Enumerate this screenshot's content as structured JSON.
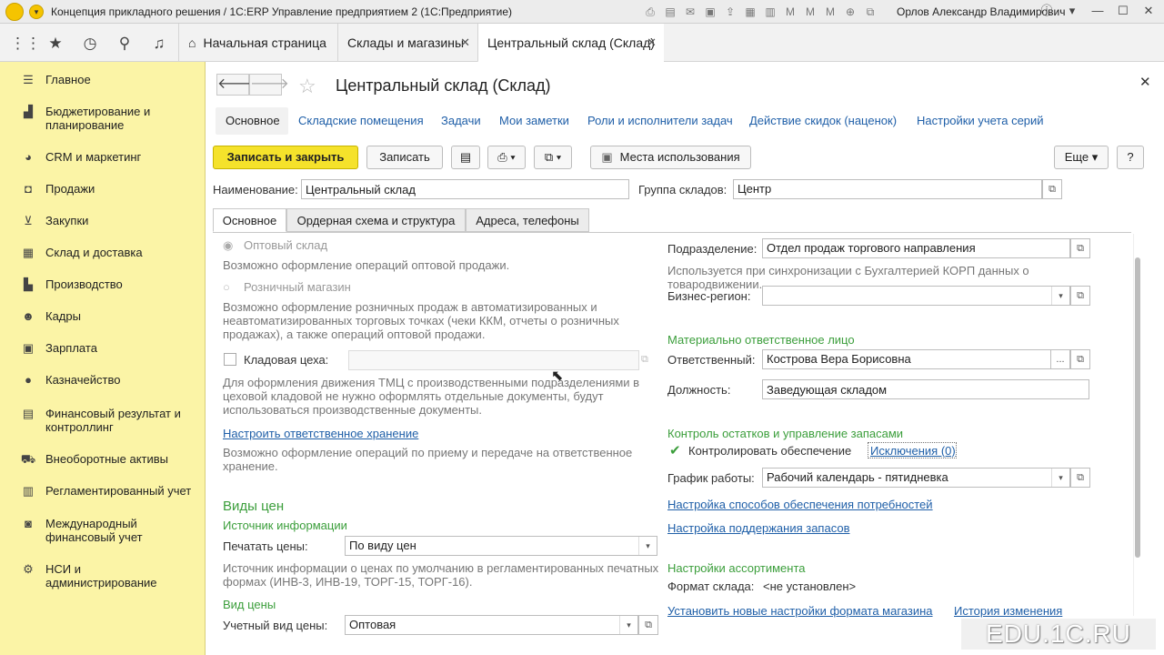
{
  "window": {
    "title": "Концепция прикладного решения / 1С:ERP Управление предприятием 2  (1С:Предприятие)",
    "user": "Орлов Александр Владимирович"
  },
  "tabs": [
    {
      "label": "Начальная страница"
    },
    {
      "label": "Склады и магазины"
    },
    {
      "label": "Центральный склад (Склад)"
    }
  ],
  "sidebar": {
    "items": [
      {
        "label": "Главное"
      },
      {
        "label": "Бюджетирование и планирование"
      },
      {
        "label": "CRM и маркетинг"
      },
      {
        "label": "Продажи"
      },
      {
        "label": "Закупки"
      },
      {
        "label": "Склад и доставка"
      },
      {
        "label": "Производство"
      },
      {
        "label": "Кадры"
      },
      {
        "label": "Зарплата"
      },
      {
        "label": "Казначейство"
      },
      {
        "label": "Финансовый результат и контроллинг"
      },
      {
        "label": "Внеоборотные активы"
      },
      {
        "label": "Регламентированный учет"
      },
      {
        "label": "Международный финансовый учет"
      },
      {
        "label": "НСИ и администрирование"
      }
    ]
  },
  "form": {
    "title": "Центральный склад (Склад)",
    "links": [
      "Основное",
      "Складские помещения",
      "Задачи",
      "Мои заметки",
      "Роли и исполнители задач",
      "Действие скидок (наценок)",
      "Настройки учета серий"
    ],
    "buttons": {
      "save_close": "Записать и закрыть",
      "save": "Записать",
      "usage": "Места использования",
      "more": "Еще",
      "help": "?"
    },
    "name_label": "Наименование:",
    "name_value": "Центральный склад",
    "group_label": "Группа складов:",
    "group_value": "Центр",
    "tabs": [
      "Основное",
      "Ордерная схема и структура",
      "Адреса, телефоны"
    ],
    "left": {
      "wholesale": "Оптовый склад",
      "wholesale_desc": "Возможно оформление операций оптовой продажи.",
      "retail": "Розничный магазин",
      "retail_desc": "Возможно оформление розничных продаж в автоматизированных и неавтоматизированных торговых точках (чеки ККМ, отчеты о розничных продажах), а также операций оптовой продажи.",
      "shop_store": "Кладовая цеха:",
      "shop_store_desc": "Для оформления движения ТМЦ с производственными подразделениями в цеховой кладовой не нужно оформлять отдельные документы, будут использоваться производственные документы.",
      "resp_link": "Настроить ответственное хранение",
      "resp_desc": "Возможно оформление операций по приему и передаче на ответственное хранение.",
      "prices_head": "Виды цен",
      "source_head": "Источник информации",
      "print_label": "Печатать цены:",
      "print_value": "По виду цен",
      "print_desc": "Источник информации о ценах по умолчанию в регламентированных печатных формах (ИНВ-3, ИНВ-19, ТОРГ-15, ТОРГ-16).",
      "price_type_head": "Вид цены",
      "acc_label": "Учетный вид цены:",
      "acc_value": "Оптовая"
    },
    "right": {
      "div_label": "Подразделение:",
      "div_value": "Отдел продаж торгового направления",
      "div_desc": "Используется при синхронизации с Бухгалтерией КОРП данных о товародвижении.",
      "region_label": "Бизнес-регион:",
      "region_value": "",
      "mat_head": "Материально ответственное лицо",
      "resp_label": "Ответственный:",
      "resp_value": "Кострова Вера Борисовна",
      "pos_label": "Должность:",
      "pos_value": "Заведующая складом",
      "ctrl_head": "Контроль остатков и управление запасами",
      "ctrl_check": "Контролировать обеспечение",
      "exceptions": "Исключения (0)",
      "sched_label": "График работы:",
      "sched_value": "Рабочий календарь - пятидневка",
      "link1": "Настройка способов обеспечения потребностей",
      "link2": "Настройка поддержания запасов",
      "assort_head": "Настройки ассортимента",
      "fmt_label": "Формат склада:",
      "fmt_value": "<не установлен>",
      "link3": "Установить новые настройки формата магазина",
      "link4": "История изменения"
    }
  },
  "watermark": "EDU.1C.RU"
}
